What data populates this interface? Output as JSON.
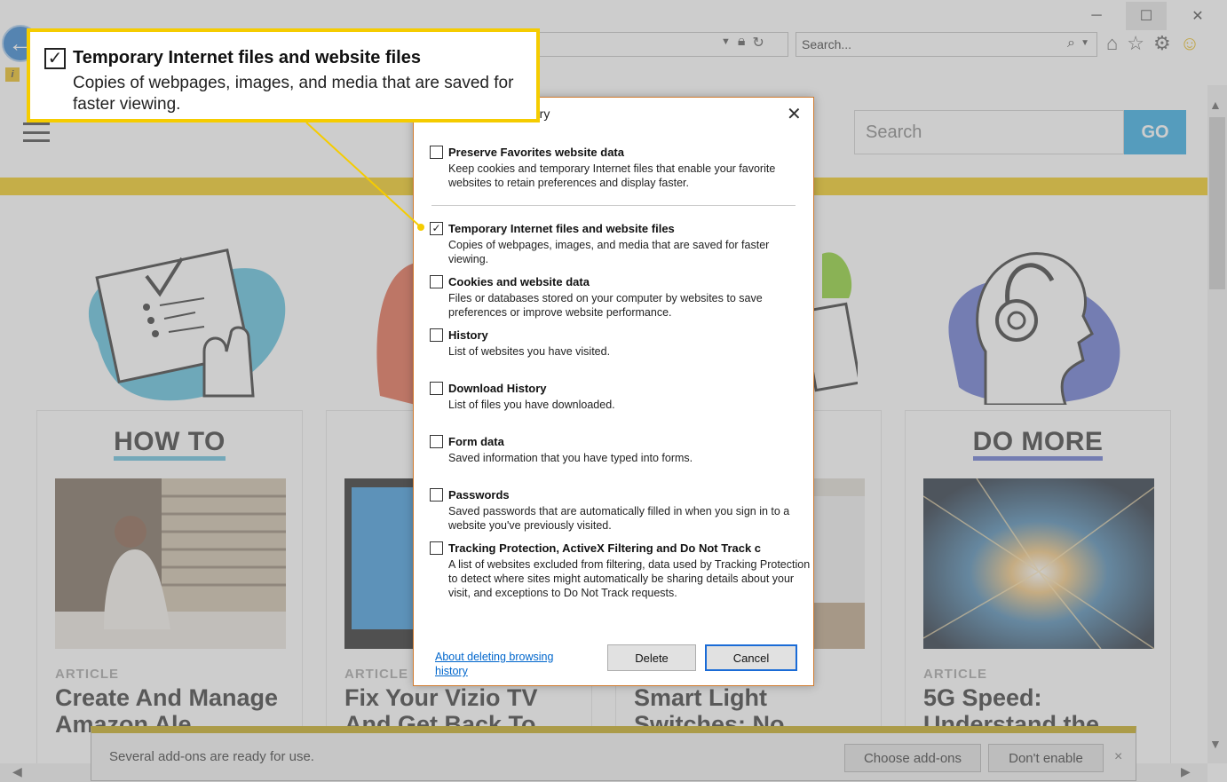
{
  "browser": {
    "search_placeholder": "Search...",
    "min_icon": "─",
    "max_icon": "☐",
    "close_icon": "✕"
  },
  "site": {
    "search_placeholder": "Search",
    "go_label": "GO",
    "cards": [
      {
        "heading": "HOW TO",
        "tag": "ARTICLE",
        "title": "Create And Manage Amazon Ale"
      },
      {
        "heading": "",
        "tag": "ARTICLE",
        "title": "Fix Your Vizio TV And Get Back To"
      },
      {
        "heading": "",
        "tag": "",
        "title": "Smart Light Switches: No"
      },
      {
        "heading": "DO MORE",
        "tag": "ARTICLE",
        "title": "5G Speed: Understand the"
      }
    ]
  },
  "notification": {
    "text": "Several add-ons are ready for use.",
    "choose_label": "Choose add-ons",
    "dont_enable_label": "Don't enable",
    "close_label": "×"
  },
  "dialog": {
    "title": "tory",
    "close_label": "✕",
    "options": [
      {
        "label": "Preserve Favorites website data",
        "desc": "Keep cookies and temporary Internet files that enable your favorite websites to retain preferences and display faster.",
        "checked": false
      },
      {
        "label": "Temporary Internet files and website files",
        "desc": "Copies of webpages, images, and media that are saved for faster viewing.",
        "checked": true
      },
      {
        "label": "Cookies and website data",
        "desc": "Files or databases stored on your computer by websites to save preferences or improve website performance.",
        "checked": false
      },
      {
        "label": "History",
        "desc": "List of websites you have visited.",
        "checked": false
      },
      {
        "label": "Download History",
        "desc": "List of files you have downloaded.",
        "checked": false
      },
      {
        "label": "Form data",
        "desc": "Saved information that you have typed into forms.",
        "checked": false
      },
      {
        "label": "Passwords",
        "desc": "Saved passwords that are automatically filled in when you sign in to a website you've previously visited.",
        "checked": false
      },
      {
        "label": "Tracking Protection, ActiveX Filtering and Do Not Track c",
        "desc": "A list of websites excluded from filtering, data used by Tracking Protection to detect where sites might automatically be sharing details about your visit, and exceptions to Do Not Track requests.",
        "checked": false
      }
    ],
    "about_link": "About deleting browsing history",
    "delete_label": "Delete",
    "cancel_label": "Cancel"
  },
  "callout": {
    "title": "Temporary Internet files and website files",
    "desc": "Copies of webpages, images, and media that are saved for faster viewing."
  },
  "colors": {
    "accent_yellow": "#f5cc00",
    "go_blue": "#1aa1e0",
    "dialog_border": "#d07a2e"
  }
}
